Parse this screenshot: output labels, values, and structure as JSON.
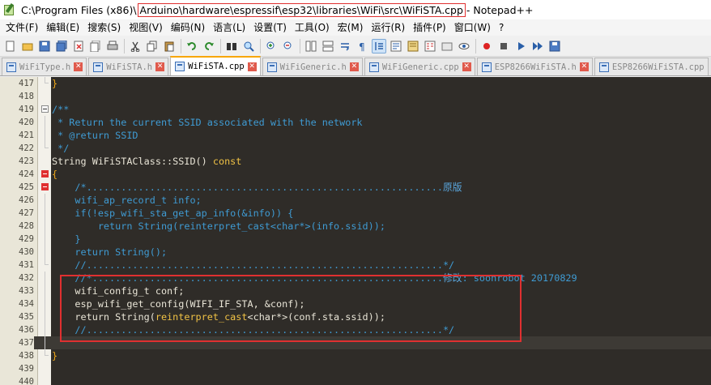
{
  "window": {
    "title_prefix": "C:\\Program Files (x86)\\",
    "title_path": "Arduino\\hardware\\espressif\\esp32\\libraries\\WiFi\\src\\WiFiSTA.cpp",
    "title_suffix": " - Notepad++"
  },
  "menu": {
    "items": [
      "文件(F)",
      "编辑(E)",
      "搜索(S)",
      "视图(V)",
      "编码(N)",
      "语言(L)",
      "设置(T)",
      "工具(O)",
      "宏(M)",
      "运行(R)",
      "插件(P)",
      "窗口(W)",
      "?"
    ]
  },
  "tabs": [
    {
      "label": "WiFiType.h",
      "active": false
    },
    {
      "label": "WiFiSTA.h",
      "active": false
    },
    {
      "label": "WiFiSTA.cpp",
      "active": true
    },
    {
      "label": "WiFiGeneric.h",
      "active": false
    },
    {
      "label": "WiFiGeneric.cpp",
      "active": false
    },
    {
      "label": "ESP8266WiFiSTA.h",
      "active": false
    },
    {
      "label": "ESP8266WiFiSTA.cpp",
      "active": false
    }
  ],
  "editor": {
    "line_numbers": [
      "417",
      "418",
      "419",
      "420",
      "421",
      "422",
      "423",
      "424",
      "425",
      "426",
      "427",
      "428",
      "429",
      "430",
      "431",
      "432",
      "433",
      "434",
      "435",
      "436",
      "437",
      "438",
      "439",
      "440"
    ],
    "code": {
      "l417": "}",
      "l419": "/**",
      "l420": " * Return the current SSID associated with the network",
      "l421": " * @return SSID",
      "l422": " */",
      "l423a": "String WiFiSTAClass::SSID() ",
      "l423b": "const",
      "l424": "{",
      "l425a": "    /*..............................................................",
      "l425b": "原版",
      "l426": "    wifi_ap_record_t info;",
      "l427": "    if(!esp_wifi_sta_get_ap_info(&info)) {",
      "l428a": "        return String(",
      "l428b": "reinterpret_cast",
      "l428c": "<char*>(info.ssid));",
      "l429": "    }",
      "l430": "    return String();",
      "l431": "    //..............................................................*/",
      "l432a": "    //*.............................................................",
      "l432b": "修改",
      "l432c": ": soonrobot 20170829",
      "l433": "    wifi_config_t conf;",
      "l434": "    esp_wifi_get_config(WIFI_IF_STA, &conf);",
      "l435a": "    return String(",
      "l435b": "reinterpret_cast",
      "l435c": "<char*>(conf.sta.ssid));",
      "l436": "    //..............................................................*/",
      "l438": "}"
    }
  },
  "colors": {
    "editor_bg": "#2f2c28",
    "comment": "#3f9bd3",
    "keyword": "#f0c245",
    "highlight": "#e03030",
    "active_tab_accent": "#f7a600"
  }
}
